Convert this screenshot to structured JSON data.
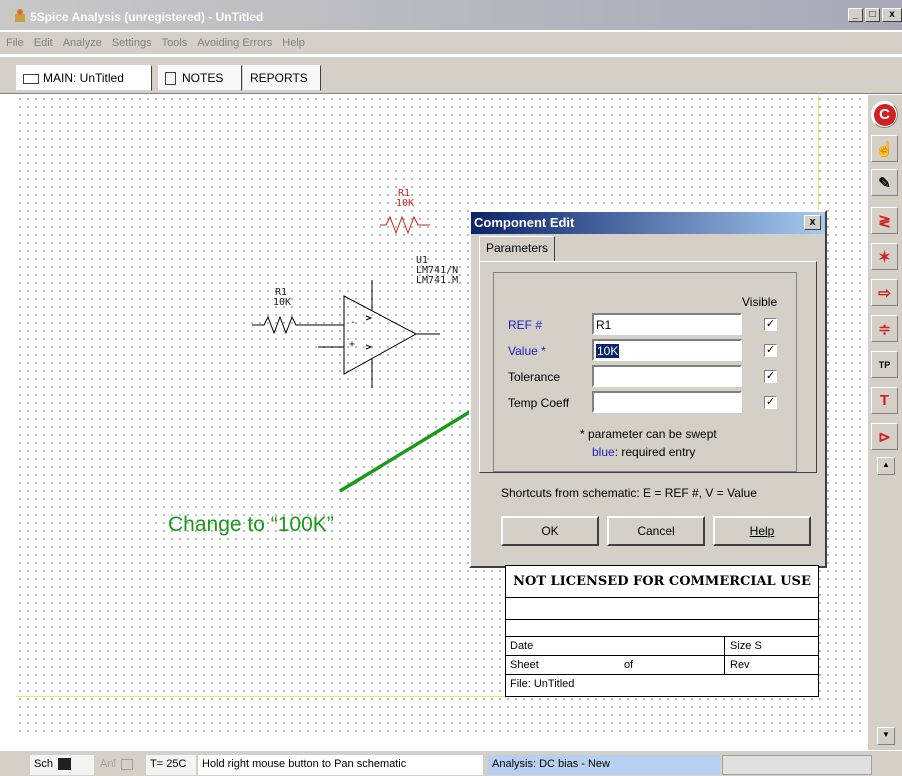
{
  "window": {
    "title": "5Spice Analysis (unregistered) - UnTitled",
    "min_label": "_",
    "max_label": "□",
    "close_label": "x"
  },
  "menu": [
    "File",
    "Edit",
    "Analyze",
    "Settings",
    "Tools",
    "Avoiding Errors",
    "Help"
  ],
  "tabs": {
    "main": "MAIN: UnTitled",
    "notes": "NOTES",
    "reports": "REPORTS"
  },
  "schematic": {
    "r1_top_ref": "R1",
    "r1_top_val": "10K",
    "r1_ref": "R1",
    "r1_val": "10K",
    "u1_ref": "U1",
    "u1_line1": "LM741/N",
    "u1_line2": "LM741.M",
    "minus": "-",
    "plus": "+"
  },
  "toolbar": [
    "c-icon",
    "hand-icon",
    "pencil-icon",
    "resistor-icon",
    "diode-icon",
    "source-icon",
    "ground-icon",
    "testpoint-icon",
    "text-icon",
    "opamp-icon"
  ],
  "dialog": {
    "title": "Component Edit",
    "close": "x",
    "tab": "Parameters",
    "visible_header": "Visible",
    "fields": [
      {
        "label": "REF #",
        "value": "R1",
        "required": true,
        "checked": true
      },
      {
        "label": "Value *",
        "value": "10K",
        "required": true,
        "checked": true
      },
      {
        "label": "Tolerance",
        "value": "",
        "required": false,
        "checked": true
      },
      {
        "label": "Temp Coeff",
        "value": "",
        "required": false,
        "checked": true
      }
    ],
    "note1": "* parameter can be swept",
    "note2_blue": "blue",
    "note2_rest": ": required entry",
    "shortcuts": "Shortcuts from schematic:  E = REF #,  V = Value",
    "ok": "OK",
    "cancel": "Cancel",
    "help": "Help"
  },
  "title_block": {
    "header": "NOT LICENSED FOR COMMERCIAL USE",
    "date": "Date",
    "size": "Size  S",
    "sheet": "Sheet",
    "of": "of",
    "rev": "Rev",
    "file": "File:  UnTitled"
  },
  "annotation": "Change to “100K”",
  "status": {
    "sch": "Sch",
    "anl": "Anl",
    "temp": "T= 25C",
    "hint": "Hold right mouse button to Pan schematic",
    "analysis": "Analysis:  DC bias - New"
  },
  "colors": {
    "accent_red": "#d02020",
    "title_blue": "#0a246a",
    "annotation_green": "#1a9a1a",
    "required_blue": "#2020c0"
  }
}
